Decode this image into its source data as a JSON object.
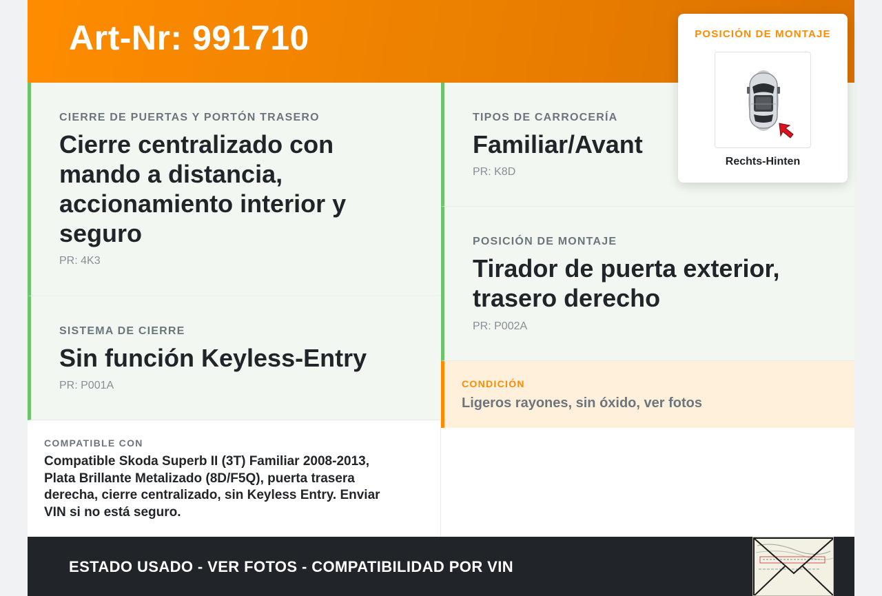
{
  "header": {
    "title": "Art-Nr: 991710"
  },
  "specs": {
    "cierre": {
      "label": "CIERRE DE PUERTAS Y PORTÓN TRASERO",
      "lines": [
        "Cierre centralizado con",
        "mando a distancia,",
        "accionamiento interior y",
        "seguro"
      ],
      "pr": "PR: 4K3"
    },
    "sistema": {
      "label": "SISTEMA DE CIERRE",
      "value": "Sin función Keyless-Entry",
      "pr": "PR: P001A"
    },
    "carroceria": {
      "label": "TIPOS DE CARROCERÍA",
      "value": "Familiar/Avant",
      "pr": "PR: K8D"
    },
    "posicion": {
      "label": "POSICIÓN DE MONTAJE",
      "lines": [
        "Tirador de puerta exterior,",
        "trasero derecho"
      ],
      "pr": "PR: P002A"
    }
  },
  "condition": {
    "label": "CONDICIÓN",
    "text": "Ligeros rayones, sin óxido, ver fotos"
  },
  "compat": {
    "label": "COMPATIBLE CON",
    "lines": [
      "Compatible Skoda Superb II (3T) Familiar 2008-2013,",
      "Plata Brillante Metalizado (8D/F5Q), puerta trasera",
      "derecha, cierre centralizado, sin Keyless Entry. Enviar",
      "VIN si no está seguro."
    ]
  },
  "mount_card": {
    "title": "POSICIÓN DE MONTAJE",
    "caption": "Rechts-Hinten",
    "image_icon": "car-top-view-icon",
    "marker_icon": "arrow-pointer-icon"
  },
  "footer": {
    "text": "ESTADO USADO - VER FOTOS - COMPATIBILIDAD POR VIN",
    "thumb_icon": "envelope-thumbnail-icon"
  },
  "colors": {
    "accent": "#ff8c00",
    "spec_border": "#6cc56a",
    "spec_bg": "#f2f8f1",
    "condition_bg": "#fff0dc",
    "footer_bg": "#212529",
    "arrow": "#d9121f"
  }
}
